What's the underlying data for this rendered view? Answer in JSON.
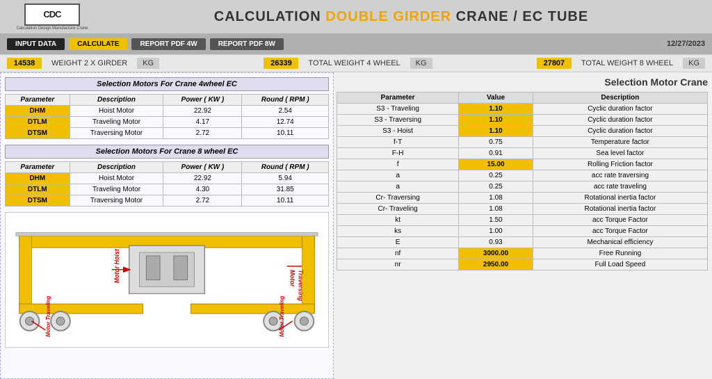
{
  "header": {
    "title_prefix": "CALCULATION ",
    "title_highlight": "DOUBLE GIRDER",
    "title_suffix": " CRANE / EC TUBE",
    "logo_main": "CDC",
    "logo_sub": "Calculation Design Manufacture Crane"
  },
  "toolbar": {
    "input_data_label": "INPUT DATA",
    "calculate_label": "CALCULATE",
    "report_4w_label": "REPORT PDF 4W",
    "report_8w_label": "REPORT PDF 8W",
    "date": "12/27/2023"
  },
  "weight_bar": {
    "weight1_value": "14538",
    "weight1_label": "WEIGHT 2 X GIRDER",
    "weight1_unit": "KG",
    "weight2_value": "26339",
    "weight2_label": "TOTAL WEIGHT 4 WHEEL",
    "weight2_unit": "KG",
    "weight3_value": "27807",
    "weight3_label": "TOTAL WEIGHT 8 WHEEL",
    "weight3_unit": "KG"
  },
  "section1": {
    "title": "Selection Motors For Crane 4wheel EC",
    "columns": [
      "Parameter",
      "Description",
      "Power ( KW )",
      "Round ( RPM )"
    ],
    "rows": [
      {
        "param": "DHM",
        "desc": "Hoist Motor",
        "power": "22.92",
        "round": "2.54"
      },
      {
        "param": "DTLM",
        "desc": "Traveling Motor",
        "power": "4.17",
        "round": "12.74"
      },
      {
        "param": "DTSM",
        "desc": "Traversing Motor",
        "power": "2.72",
        "round": "10.11"
      }
    ]
  },
  "section2": {
    "title": "Selection Motors For Crane 8 wheel EC",
    "columns": [
      "Parameter",
      "Description",
      "Power ( KW )",
      "Round ( RPM )"
    ],
    "rows": [
      {
        "param": "DHM",
        "desc": "Hoist Motor",
        "power": "22.92",
        "round": "5.94"
      },
      {
        "param": "DTLM",
        "desc": "Traveling Motor",
        "power": "4.30",
        "round": "31.85"
      },
      {
        "param": "DTSM",
        "desc": "Traversing Motor",
        "power": "2.72",
        "round": "10.11"
      }
    ]
  },
  "right_title": "Selection Motor Crane",
  "param_table": {
    "columns": [
      "Parameter",
      "Value",
      "Description"
    ],
    "rows": [
      {
        "param": "S3 - Traveling",
        "value": "1.10",
        "desc": "Cyclic duration factor",
        "highlight": true
      },
      {
        "param": "S3 - Traversing",
        "value": "1.10",
        "desc": "Cyclic duration factor",
        "highlight": true
      },
      {
        "param": "S3 - Hoist",
        "value": "1.10",
        "desc": "Cyclic duration factor",
        "highlight": true
      },
      {
        "param": "f-T",
        "value": "0.75",
        "desc": "Temperature factor",
        "highlight": false
      },
      {
        "param": "F-H",
        "value": "0.91",
        "desc": "Sea level factor",
        "highlight": false
      },
      {
        "param": "f",
        "value": "15.00",
        "desc": "Rolling Friction factor",
        "highlight": true
      },
      {
        "param": "a",
        "value": "0.25",
        "desc": "acc rate traversing",
        "highlight": false
      },
      {
        "param": "a",
        "value": "0.25",
        "desc": "acc rate traveling",
        "highlight": false
      },
      {
        "param": "Cr- Traversing",
        "value": "1.08",
        "desc": "Rotational inertia factor",
        "highlight": false
      },
      {
        "param": "Cr- Traveling",
        "value": "1.08",
        "desc": "Rotational inertia factor",
        "highlight": false
      },
      {
        "param": "kt",
        "value": "1.50",
        "desc": "acc Torque Factor",
        "highlight": false
      },
      {
        "param": "ks",
        "value": "1.00",
        "desc": "acc Torque Factor",
        "highlight": false
      },
      {
        "param": "E",
        "value": "0.93",
        "desc": "Mechanical efficiency",
        "highlight": false
      },
      {
        "param": "nf",
        "value": "3000.00",
        "desc": "Free Running",
        "highlight": true
      },
      {
        "param": "nr",
        "value": "2950.00",
        "desc": "Full Load Speed",
        "highlight": true
      }
    ]
  }
}
